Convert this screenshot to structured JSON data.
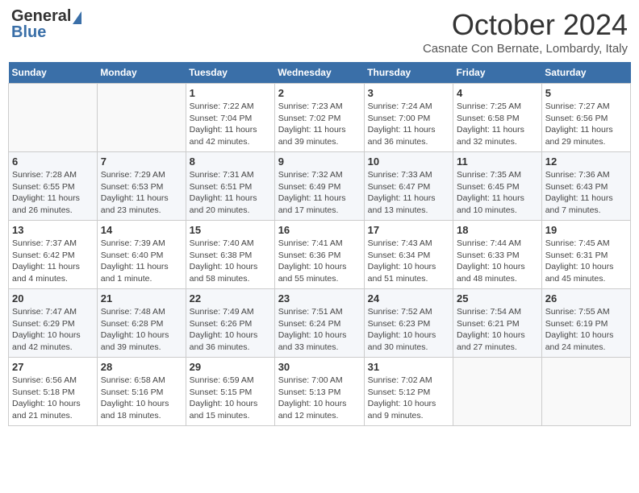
{
  "header": {
    "logo_general": "General",
    "logo_blue": "Blue",
    "month": "October 2024",
    "location": "Casnate Con Bernate, Lombardy, Italy"
  },
  "weekdays": [
    "Sunday",
    "Monday",
    "Tuesday",
    "Wednesday",
    "Thursday",
    "Friday",
    "Saturday"
  ],
  "weeks": [
    [
      null,
      null,
      {
        "day": "1",
        "sunrise": "Sunrise: 7:22 AM",
        "sunset": "Sunset: 7:04 PM",
        "daylight": "Daylight: 11 hours and 42 minutes."
      },
      {
        "day": "2",
        "sunrise": "Sunrise: 7:23 AM",
        "sunset": "Sunset: 7:02 PM",
        "daylight": "Daylight: 11 hours and 39 minutes."
      },
      {
        "day": "3",
        "sunrise": "Sunrise: 7:24 AM",
        "sunset": "Sunset: 7:00 PM",
        "daylight": "Daylight: 11 hours and 36 minutes."
      },
      {
        "day": "4",
        "sunrise": "Sunrise: 7:25 AM",
        "sunset": "Sunset: 6:58 PM",
        "daylight": "Daylight: 11 hours and 32 minutes."
      },
      {
        "day": "5",
        "sunrise": "Sunrise: 7:27 AM",
        "sunset": "Sunset: 6:56 PM",
        "daylight": "Daylight: 11 hours and 29 minutes."
      }
    ],
    [
      {
        "day": "6",
        "sunrise": "Sunrise: 7:28 AM",
        "sunset": "Sunset: 6:55 PM",
        "daylight": "Daylight: 11 hours and 26 minutes."
      },
      {
        "day": "7",
        "sunrise": "Sunrise: 7:29 AM",
        "sunset": "Sunset: 6:53 PM",
        "daylight": "Daylight: 11 hours and 23 minutes."
      },
      {
        "day": "8",
        "sunrise": "Sunrise: 7:31 AM",
        "sunset": "Sunset: 6:51 PM",
        "daylight": "Daylight: 11 hours and 20 minutes."
      },
      {
        "day": "9",
        "sunrise": "Sunrise: 7:32 AM",
        "sunset": "Sunset: 6:49 PM",
        "daylight": "Daylight: 11 hours and 17 minutes."
      },
      {
        "day": "10",
        "sunrise": "Sunrise: 7:33 AM",
        "sunset": "Sunset: 6:47 PM",
        "daylight": "Daylight: 11 hours and 13 minutes."
      },
      {
        "day": "11",
        "sunrise": "Sunrise: 7:35 AM",
        "sunset": "Sunset: 6:45 PM",
        "daylight": "Daylight: 11 hours and 10 minutes."
      },
      {
        "day": "12",
        "sunrise": "Sunrise: 7:36 AM",
        "sunset": "Sunset: 6:43 PM",
        "daylight": "Daylight: 11 hours and 7 minutes."
      }
    ],
    [
      {
        "day": "13",
        "sunrise": "Sunrise: 7:37 AM",
        "sunset": "Sunset: 6:42 PM",
        "daylight": "Daylight: 11 hours and 4 minutes."
      },
      {
        "day": "14",
        "sunrise": "Sunrise: 7:39 AM",
        "sunset": "Sunset: 6:40 PM",
        "daylight": "Daylight: 11 hours and 1 minute."
      },
      {
        "day": "15",
        "sunrise": "Sunrise: 7:40 AM",
        "sunset": "Sunset: 6:38 PM",
        "daylight": "Daylight: 10 hours and 58 minutes."
      },
      {
        "day": "16",
        "sunrise": "Sunrise: 7:41 AM",
        "sunset": "Sunset: 6:36 PM",
        "daylight": "Daylight: 10 hours and 55 minutes."
      },
      {
        "day": "17",
        "sunrise": "Sunrise: 7:43 AM",
        "sunset": "Sunset: 6:34 PM",
        "daylight": "Daylight: 10 hours and 51 minutes."
      },
      {
        "day": "18",
        "sunrise": "Sunrise: 7:44 AM",
        "sunset": "Sunset: 6:33 PM",
        "daylight": "Daylight: 10 hours and 48 minutes."
      },
      {
        "day": "19",
        "sunrise": "Sunrise: 7:45 AM",
        "sunset": "Sunset: 6:31 PM",
        "daylight": "Daylight: 10 hours and 45 minutes."
      }
    ],
    [
      {
        "day": "20",
        "sunrise": "Sunrise: 7:47 AM",
        "sunset": "Sunset: 6:29 PM",
        "daylight": "Daylight: 10 hours and 42 minutes."
      },
      {
        "day": "21",
        "sunrise": "Sunrise: 7:48 AM",
        "sunset": "Sunset: 6:28 PM",
        "daylight": "Daylight: 10 hours and 39 minutes."
      },
      {
        "day": "22",
        "sunrise": "Sunrise: 7:49 AM",
        "sunset": "Sunset: 6:26 PM",
        "daylight": "Daylight: 10 hours and 36 minutes."
      },
      {
        "day": "23",
        "sunrise": "Sunrise: 7:51 AM",
        "sunset": "Sunset: 6:24 PM",
        "daylight": "Daylight: 10 hours and 33 minutes."
      },
      {
        "day": "24",
        "sunrise": "Sunrise: 7:52 AM",
        "sunset": "Sunset: 6:23 PM",
        "daylight": "Daylight: 10 hours and 30 minutes."
      },
      {
        "day": "25",
        "sunrise": "Sunrise: 7:54 AM",
        "sunset": "Sunset: 6:21 PM",
        "daylight": "Daylight: 10 hours and 27 minutes."
      },
      {
        "day": "26",
        "sunrise": "Sunrise: 7:55 AM",
        "sunset": "Sunset: 6:19 PM",
        "daylight": "Daylight: 10 hours and 24 minutes."
      }
    ],
    [
      {
        "day": "27",
        "sunrise": "Sunrise: 6:56 AM",
        "sunset": "Sunset: 5:18 PM",
        "daylight": "Daylight: 10 hours and 21 minutes."
      },
      {
        "day": "28",
        "sunrise": "Sunrise: 6:58 AM",
        "sunset": "Sunset: 5:16 PM",
        "daylight": "Daylight: 10 hours and 18 minutes."
      },
      {
        "day": "29",
        "sunrise": "Sunrise: 6:59 AM",
        "sunset": "Sunset: 5:15 PM",
        "daylight": "Daylight: 10 hours and 15 minutes."
      },
      {
        "day": "30",
        "sunrise": "Sunrise: 7:00 AM",
        "sunset": "Sunset: 5:13 PM",
        "daylight": "Daylight: 10 hours and 12 minutes."
      },
      {
        "day": "31",
        "sunrise": "Sunrise: 7:02 AM",
        "sunset": "Sunset: 5:12 PM",
        "daylight": "Daylight: 10 hours and 9 minutes."
      },
      null,
      null
    ]
  ]
}
